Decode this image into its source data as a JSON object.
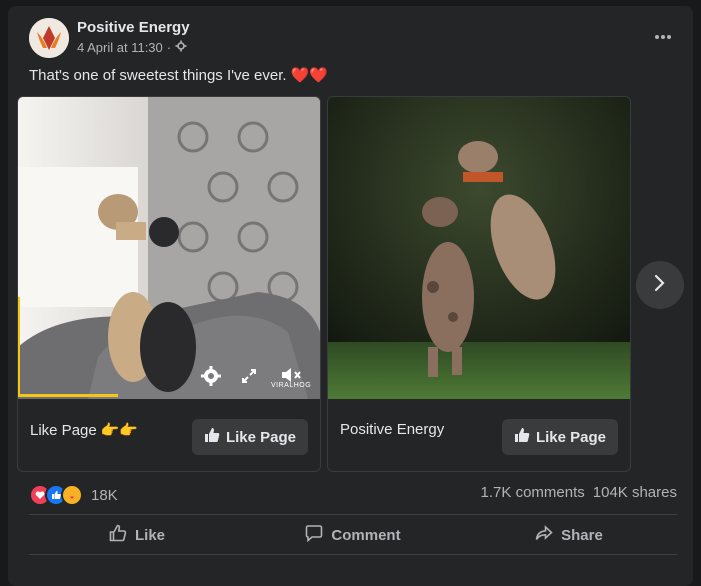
{
  "post": {
    "page_name": "Positive Energy",
    "timestamp": "4 April at 11:30",
    "separator": "·",
    "caption": "That's one of sweetest things I've ever.",
    "caption_emoji": "❤️❤️"
  },
  "carousel": {
    "items": [
      {
        "title": "Like Page",
        "title_emoji": "👉👉",
        "button_label": "Like Page",
        "watermark": "VIRALHOG"
      },
      {
        "title": "Positive Energy",
        "button_label": "Like Page"
      }
    ]
  },
  "stats": {
    "reactions_count": "18K",
    "comments": "1.7K comments",
    "shares": "104K shares"
  },
  "actions": {
    "like": "Like",
    "comment": "Comment",
    "share": "Share"
  },
  "colors": {
    "background": "#18191a",
    "card": "#242526",
    "text_primary": "#e4e6eb",
    "text_secondary": "#b0b3b8",
    "button": "#3a3b3c",
    "progress_accent": "#f5c518"
  },
  "icons": [
    "more-icon",
    "globe-settings-icon",
    "settings-icon",
    "fullscreen-icon",
    "mute-icon",
    "thumbs-up-icon",
    "chevron-right-icon",
    "like-icon",
    "comment-icon",
    "share-icon"
  ]
}
